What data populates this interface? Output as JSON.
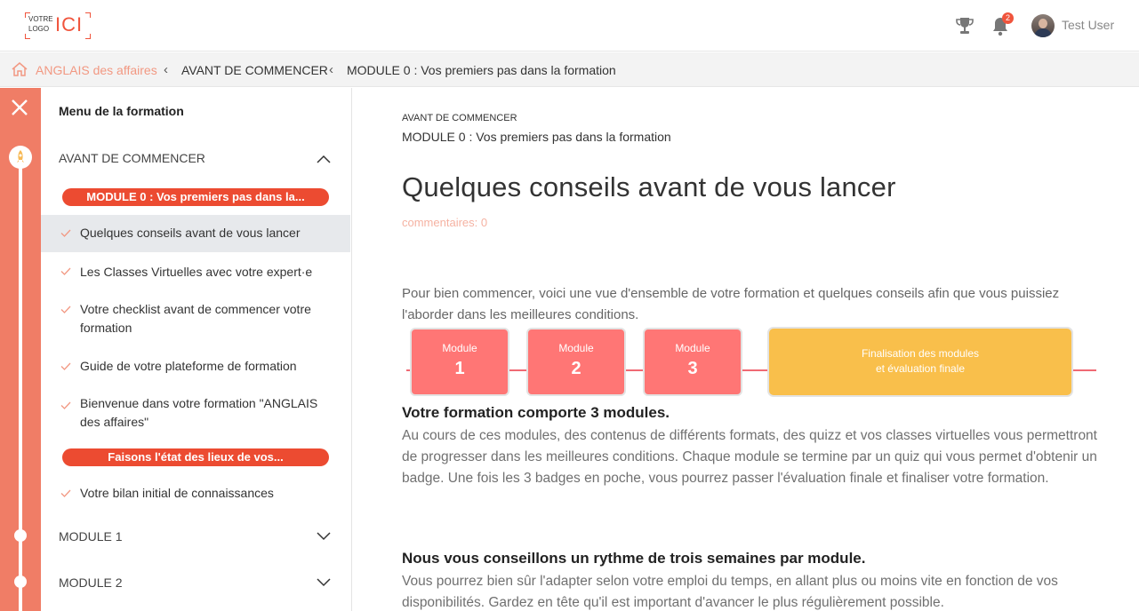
{
  "header": {
    "logo": {
      "small_line1": "VOTRE",
      "small_line2": "LOGO",
      "big": "ICI",
      "color": "#f0543c"
    },
    "trophy_icon": "trophy-icon",
    "bell_icon": "bell-icon",
    "notification_count": "2",
    "user_name": "Test User"
  },
  "breadcrumb": {
    "home_icon": "home-icon",
    "items": [
      "ANGLAIS des affaires",
      "AVANT DE COMMENCER",
      "MODULE 0 : Vos premiers pas dans la formation"
    ]
  },
  "sidebar": {
    "title": "Menu de la formation",
    "sections": [
      {
        "label": "AVANT DE COMMENCER",
        "expanded": true,
        "groups": [
          {
            "pill": "MODULE 0 : Vos premiers pas dans la...",
            "lessons": [
              "Quelques conseils avant de vous lancer",
              "Les Classes Virtuelles avec votre expert·e",
              "Votre checklist avant de commencer votre formation",
              "Guide de votre plateforme de formation",
              "Bienvenue dans votre formation \"ANGLAIS des affaires\""
            ]
          },
          {
            "pill": "Faisons l'état des lieux de vos...",
            "lessons": [
              "Votre bilan initial de connaissances"
            ]
          }
        ]
      },
      {
        "label": "MODULE 1",
        "expanded": false
      },
      {
        "label": "MODULE 2",
        "expanded": false
      }
    ],
    "active_lesson": "Quelques conseils avant de vous lancer",
    "accent": "#ec4b31"
  },
  "main": {
    "kicker": "AVANT DE COMMENCER",
    "subkicker": "MODULE 0 : Vos premiers pas dans la formation",
    "title": "Quelques conseils avant de vous lancer",
    "comments": "commentaires: 0",
    "intro": "Pour bien commencer, voici une vue d'ensemble de votre formation et quelques conseils afin que vous puissiez l'aborder dans les meilleures conditions.",
    "timeline": {
      "modules": [
        {
          "label": "Module",
          "number": "1"
        },
        {
          "label": "Module",
          "number": "2"
        },
        {
          "label": "Module",
          "number": "3"
        }
      ],
      "final_line1": "Finalisation des modules",
      "final_line2": "et évaluation finale",
      "module_color": "#ff7675",
      "final_color": "#f9bf4b"
    },
    "section1_heading": "Votre formation comporte 3 modules.",
    "section1_text": "Au cours de ces modules, des contenus de différents formats, des quizz et vos classes virtuelles vous permettront de progresser dans les meilleures conditions. Chaque module se termine par un quiz qui vous permet d'obtenir un badge. Une fois les 3 badges en poche, vous pourrez passer l'évaluation finale et finaliser votre formation.",
    "section2_heading": "Nous vous conseillons un rythme de trois semaines par module.",
    "section2_text": "Vous pourrez bien sûr l'adapter selon votre emploi du temps, en allant plus ou moins vite en fonction de vos disponibilités. Gardez en tête qu'il est important d'avancer le plus régulièrement possible."
  }
}
